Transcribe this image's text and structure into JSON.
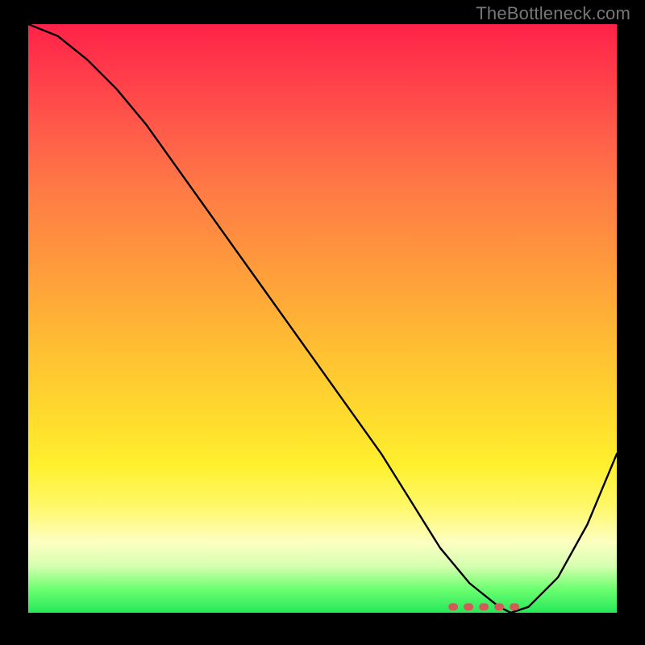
{
  "watermark": "TheBottleneck.com",
  "chart_data": {
    "type": "line",
    "title": "",
    "xlabel": "",
    "ylabel": "",
    "xlim": [
      0,
      100
    ],
    "ylim": [
      0,
      100
    ],
    "series": [
      {
        "name": "bottleneck-curve",
        "x": [
          0,
          5,
          10,
          15,
          20,
          25,
          30,
          35,
          40,
          45,
          50,
          55,
          60,
          65,
          70,
          75,
          80,
          82,
          85,
          90,
          95,
          100
        ],
        "values": [
          100,
          98,
          94,
          89,
          83,
          76,
          69,
          62,
          55,
          48,
          41,
          34,
          27,
          19,
          11,
          5,
          1,
          0,
          1,
          6,
          15,
          27
        ]
      }
    ],
    "annotations": [
      {
        "name": "optimal-band",
        "x_start": 72,
        "x_end": 85,
        "y": 1
      }
    ],
    "background": {
      "type": "vertical-gradient",
      "stops": [
        {
          "pos": 0.0,
          "color": "#ff2248"
        },
        {
          "pos": 0.08,
          "color": "#ff3b4a"
        },
        {
          "pos": 0.18,
          "color": "#ff5b4a"
        },
        {
          "pos": 0.28,
          "color": "#ff7a45"
        },
        {
          "pos": 0.38,
          "color": "#ff933e"
        },
        {
          "pos": 0.48,
          "color": "#ffac37"
        },
        {
          "pos": 0.58,
          "color": "#ffc631"
        },
        {
          "pos": 0.68,
          "color": "#ffde2d"
        },
        {
          "pos": 0.75,
          "color": "#fff02e"
        },
        {
          "pos": 0.82,
          "color": "#fff86a"
        },
        {
          "pos": 0.88,
          "color": "#fdffc2"
        },
        {
          "pos": 0.92,
          "color": "#d6ffb0"
        },
        {
          "pos": 0.96,
          "color": "#6cff70"
        },
        {
          "pos": 1.0,
          "color": "#25e85a"
        }
      ]
    }
  }
}
